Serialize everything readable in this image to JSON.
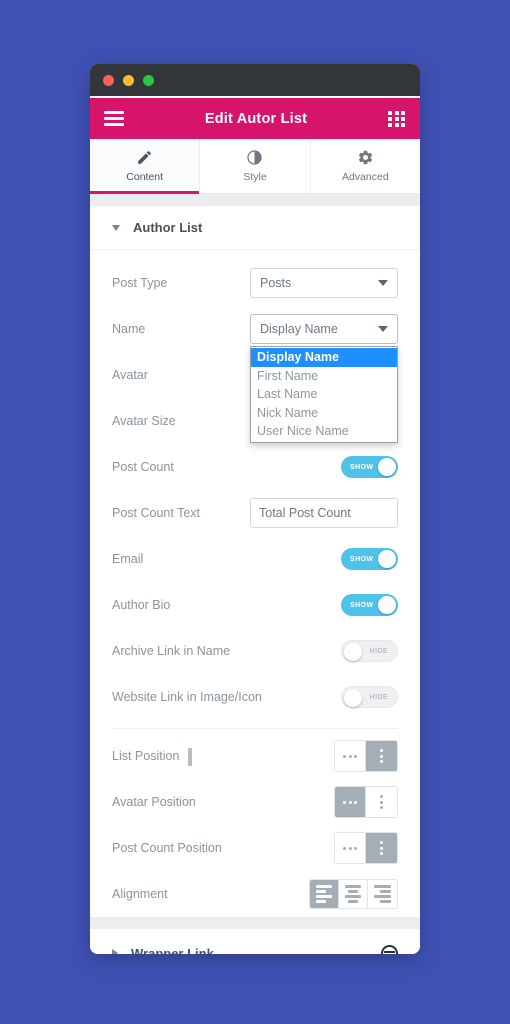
{
  "window": {
    "traffic_lights": [
      "close",
      "minimize",
      "maximize"
    ]
  },
  "appbar": {
    "menu_icon": "hamburger-icon",
    "title": "Edit Autor List",
    "grid_icon": "grid-icon"
  },
  "tabs": [
    {
      "label": "Content",
      "icon": "pencil-icon",
      "active": true
    },
    {
      "label": "Style",
      "icon": "contrast-icon",
      "active": false
    },
    {
      "label": "Advanced",
      "icon": "gear-icon",
      "active": false
    }
  ],
  "section": {
    "title": "Author List",
    "expanded": true
  },
  "controls": {
    "post_type": {
      "label": "Post Type",
      "value": "Posts"
    },
    "name": {
      "label": "Name",
      "value": "Display Name",
      "open": true,
      "options": [
        {
          "label": "Display Name",
          "selected": true
        },
        {
          "label": "First Name",
          "selected": false
        },
        {
          "label": "Last Name",
          "selected": false
        },
        {
          "label": "Nick Name",
          "selected": false
        },
        {
          "label": "User Nice Name",
          "selected": false
        }
      ]
    },
    "avatar": {
      "label": "Avatar"
    },
    "avatar_size": {
      "label": "Avatar Size"
    },
    "post_count": {
      "label": "Post Count",
      "state": "SHOW",
      "on": true
    },
    "post_count_text": {
      "label": "Post Count Text",
      "value": "Total Post Count",
      "placeholder": "Total Post Count",
      "button_icon": "dynamic-tags-icon"
    },
    "email": {
      "label": "Email",
      "state": "SHOW",
      "on": true
    },
    "author_bio": {
      "label": "Author Bio",
      "state": "SHOW",
      "on": true
    },
    "archive_link": {
      "label": "Archive Link in Name",
      "state": "HIDE",
      "on": false
    },
    "website_link": {
      "label": "Website Link in Image/Icon",
      "state": "HIDE",
      "on": false
    }
  },
  "positions": {
    "list_position": {
      "label": "List Position",
      "responsive_icon": "monitor-icon",
      "active": "vertical"
    },
    "avatar_position": {
      "label": "Avatar Position",
      "active": "horizontal"
    },
    "post_count_position": {
      "label": "Post Count Position",
      "active": "vertical"
    },
    "alignment": {
      "label": "Alignment",
      "active": "left",
      "options": [
        "left",
        "center",
        "right"
      ]
    }
  },
  "wrapper_link": {
    "title": "Wrapper Link",
    "expanded": false,
    "icon": "link-badge-icon"
  },
  "colors": {
    "page_background": "#3f51b5",
    "appbar": "#d6156a",
    "accent": "#d6156a",
    "switch_on": "#4ec3ea",
    "option_highlight": "#1e8fff",
    "choose_active": "#a4aeb6"
  }
}
